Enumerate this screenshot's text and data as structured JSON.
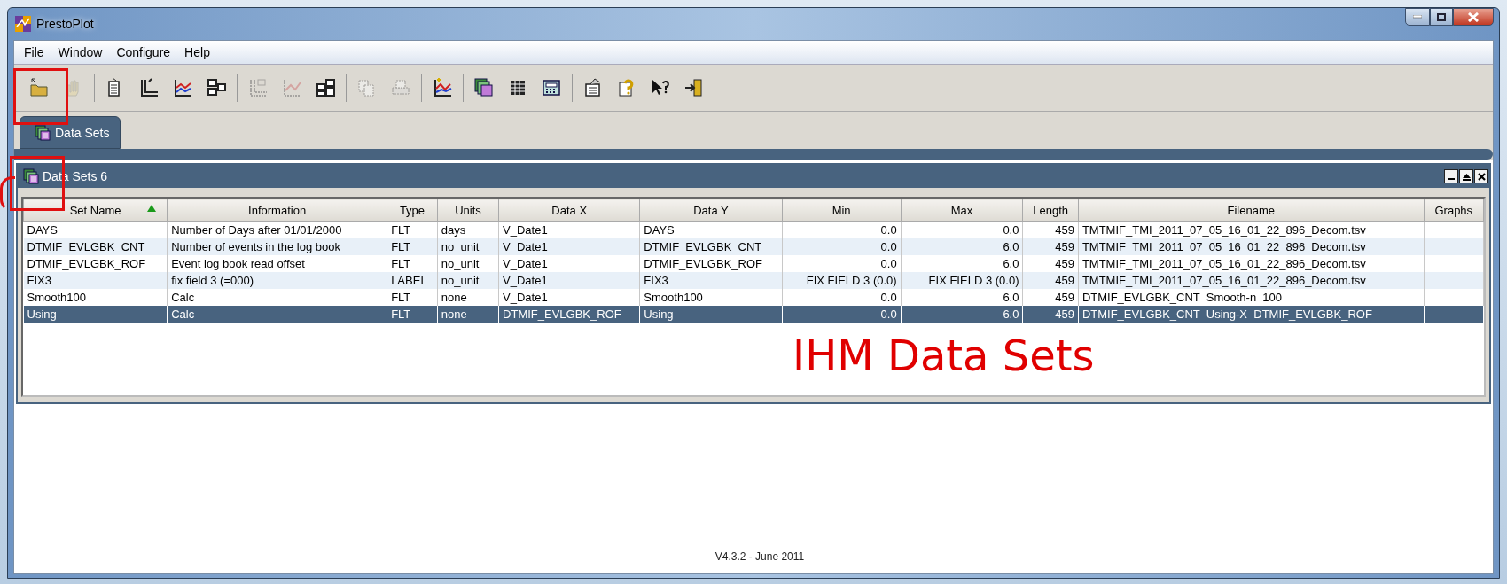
{
  "window": {
    "title": "PrestoPlot"
  },
  "menu": [
    {
      "label": "File"
    },
    {
      "label": "Window"
    },
    {
      "label": "Configure"
    },
    {
      "label": "Help"
    }
  ],
  "toolbar": [
    [
      {
        "disabled": false
      },
      {
        "disabled": true
      }
    ],
    [
      {
        "disabled": false
      },
      {
        "disabled": false
      },
      {
        "disabled": false
      },
      {
        "disabled": false
      }
    ],
    [
      {
        "disabled": true
      },
      {
        "disabled": true
      },
      {
        "disabled": false
      }
    ],
    [
      {
        "disabled": true
      },
      {
        "disabled": true
      }
    ],
    [
      {
        "disabled": false
      }
    ],
    [
      {
        "disabled": false
      },
      {
        "disabled": false
      },
      {
        "disabled": false
      }
    ],
    [
      {
        "disabled": false
      },
      {
        "disabled": false
      },
      {
        "disabled": false
      },
      {
        "disabled": false
      }
    ]
  ],
  "tabs": [
    {
      "label": "Data Sets",
      "selected": true
    }
  ],
  "data_window": {
    "title": "Data Sets 6"
  },
  "table": {
    "columns": [
      {
        "label": "Set Name",
        "sorted": true
      },
      {
        "label": "Information"
      },
      {
        "label": "Type"
      },
      {
        "label": "Units"
      },
      {
        "label": "Data X"
      },
      {
        "label": "Data Y"
      },
      {
        "label": "Min"
      },
      {
        "label": "Max"
      },
      {
        "label": "Length"
      },
      {
        "label": "Filename"
      },
      {
        "label": "Graphs"
      }
    ],
    "rows": [
      {
        "selected": false,
        "cells": [
          "DAYS",
          "Number of Days after 01/01/2000",
          "FLT",
          "days",
          "V_Date1",
          "DAYS",
          "0.0",
          "0.0",
          "459",
          "TMTMIF_TMI_2011_07_05_16_01_22_896_Decom.tsv"
        ]
      },
      {
        "selected": false,
        "cells": [
          "DTMIF_EVLGBK_CNT",
          "Number of events in the log book",
          "FLT",
          "no_unit",
          "V_Date1",
          "DTMIF_EVLGBK_CNT",
          "0.0",
          "6.0",
          "459",
          "TMTMIF_TMI_2011_07_05_16_01_22_896_Decom.tsv"
        ]
      },
      {
        "selected": false,
        "cells": [
          "DTMIF_EVLGBK_ROF",
          "Event log book read offset",
          "FLT",
          "no_unit",
          "V_Date1",
          "DTMIF_EVLGBK_ROF",
          "0.0",
          "6.0",
          "459",
          "TMTMIF_TMI_2011_07_05_16_01_22_896_Decom.tsv"
        ]
      },
      {
        "selected": false,
        "cells": [
          "FIX3",
          "fix field 3 (=000)",
          "LABEL",
          "no_unit",
          "V_Date1",
          "FIX3",
          "FIX FIELD 3 (0.0)",
          "FIX FIELD 3 (0.0)",
          "459",
          "TMTMIF_TMI_2011_07_05_16_01_22_896_Decom.tsv"
        ]
      },
      {
        "selected": false,
        "cells": [
          "Smooth100",
          "Calc",
          "FLT",
          "none",
          "V_Date1",
          "Smooth100",
          "0.0",
          "6.0",
          "459",
          "DTMIF_EVLGBK_CNT  Smooth-n  100"
        ]
      },
      {
        "selected": true,
        "cells": [
          "Using",
          "Calc",
          "FLT",
          "none",
          "DTMIF_EVLGBK_ROF",
          "Using",
          "0.0",
          "6.0",
          "459",
          "DTMIF_EVLGBK_CNT  Using-X  DTMIF_EVLGBK_ROF"
        ]
      }
    ]
  },
  "caption": "IHM Data Sets",
  "status": {
    "version": "V4.3.2 - June 2011"
  }
}
